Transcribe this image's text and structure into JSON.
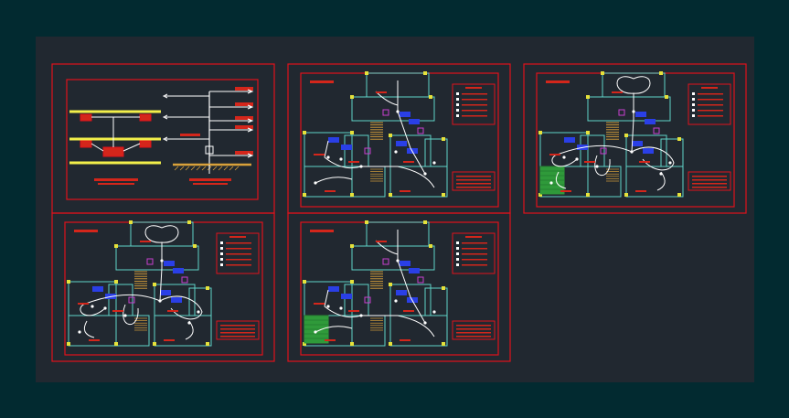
{
  "colors": {
    "viewport_bg": "#022a30",
    "model_bg": "#212830",
    "frame_red": "#e1121b",
    "wall_cyan": "#5fd3c8",
    "wire_white": "#ffffff",
    "fixture_blue": "#2a3fe6",
    "column_yellow": "#e6e23a",
    "bus_yellow": "#f2ef4a",
    "hatch_green": "#2f9a3a",
    "stair_pattern": "#d9a13a",
    "label_red": "#d4261b",
    "text_red": "#ff3b2b",
    "magenta": "#c93fd0"
  },
  "sheets": [
    {
      "id": "riser-diagram",
      "kind": "riser"
    },
    {
      "id": "plan-a",
      "kind": "plan",
      "variant": "light",
      "hatch": false
    },
    {
      "id": "plan-b",
      "kind": "plan",
      "variant": "power",
      "hatch": true
    },
    {
      "id": "plan-c",
      "kind": "plan",
      "variant": "power",
      "hatch": false
    },
    {
      "id": "plan-d",
      "kind": "plan",
      "variant": "light",
      "hatch": true
    }
  ],
  "icons": [
    "junction-box-icon",
    "ground-symbol-icon",
    "arrow-right-icon",
    "switch-icon",
    "outlet-icon"
  ]
}
